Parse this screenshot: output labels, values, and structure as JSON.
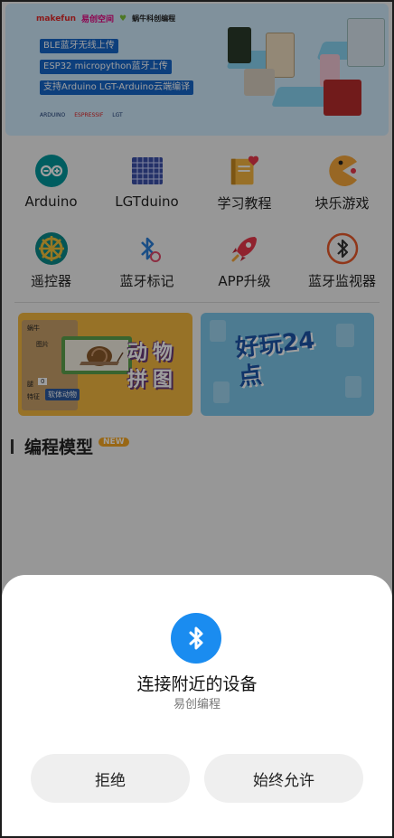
{
  "banner": {
    "brand_makefun": "makefun",
    "brand_yichuang": "易创空间",
    "brand_woniu": "蜗牛科创编程",
    "tags": [
      "BLE蓝牙无线上传",
      "ESP32 micropython蓝牙上传",
      "支持Arduino LGT-Arduino云端编译"
    ],
    "partner_logos": [
      "ARDUINO",
      "ESPRESSIF",
      "LGT"
    ]
  },
  "grid": [
    {
      "label": "Arduino",
      "icon": "arduino-icon"
    },
    {
      "label": "LGTduino",
      "icon": "keyboard-grid-icon"
    },
    {
      "label": "学习教程",
      "icon": "book-heart-icon"
    },
    {
      "label": "块乐游戏",
      "icon": "pacman-icon"
    },
    {
      "label": "遥控器",
      "icon": "steering-wheel-icon"
    },
    {
      "label": "蓝牙标记",
      "icon": "bluetooth-icon"
    },
    {
      "label": "APP升级",
      "icon": "rocket-icon"
    },
    {
      "label": "蓝牙监视器",
      "icon": "bluetooth-monitor-icon"
    }
  ],
  "cards": {
    "puzzle": {
      "title": "动物拼图",
      "panel_name": "蜗牛",
      "panel_pic": "图片",
      "panel_leg": "腿",
      "panel_leg_value": "0",
      "panel_trait": "特征",
      "panel_tag": "软体动物"
    },
    "game24": {
      "title": "好玩24点"
    }
  },
  "section": {
    "title": "编程模型",
    "badge": "NEW"
  },
  "dialog": {
    "title": "连接附近的设备",
    "app_name": "易创编程",
    "deny_label": "拒绝",
    "allow_label": "始终允许"
  },
  "colors": {
    "accent_blue": "#1a8cf0",
    "arduino_teal": "#00979c",
    "tag_blue": "#1566c9"
  }
}
